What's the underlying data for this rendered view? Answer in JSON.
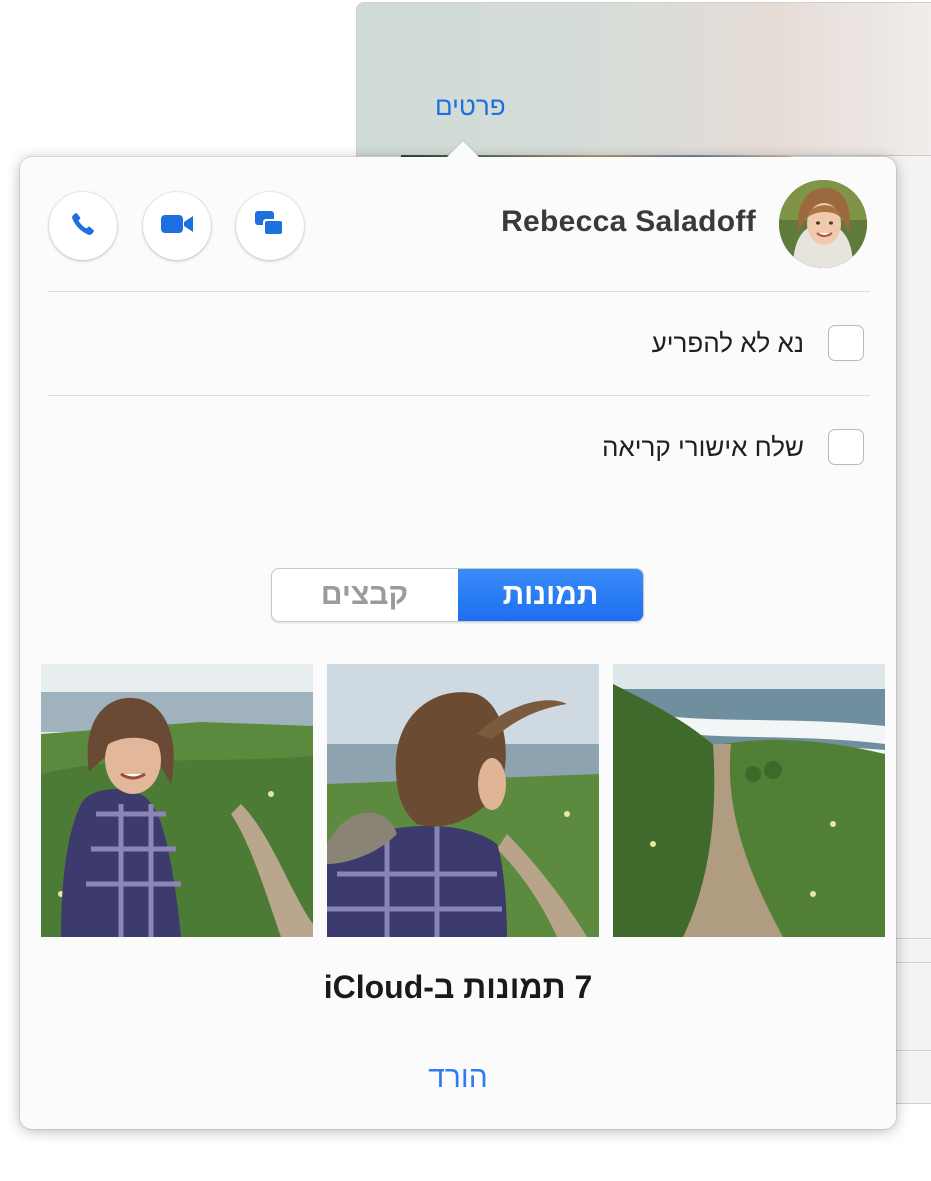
{
  "background": {
    "details_link": "פרטים"
  },
  "contact": {
    "name": "Rebecca Saladoff"
  },
  "actions": [
    {
      "name": "phone-icon"
    },
    {
      "name": "video-icon"
    },
    {
      "name": "messages-icon"
    }
  ],
  "settings": {
    "do_not_disturb": "נא לא להפריע",
    "send_read_receipts": "שלח אישורי קריאה"
  },
  "tabs": {
    "photos": "תמונות",
    "files": "קבצים",
    "selected": "תמונות"
  },
  "gallery": {
    "caption": "7 תמונות ב-iCloud",
    "download": "הורד"
  },
  "colors": {
    "accent": "#1e6fe0",
    "segment_active": "#2a7ff5"
  }
}
